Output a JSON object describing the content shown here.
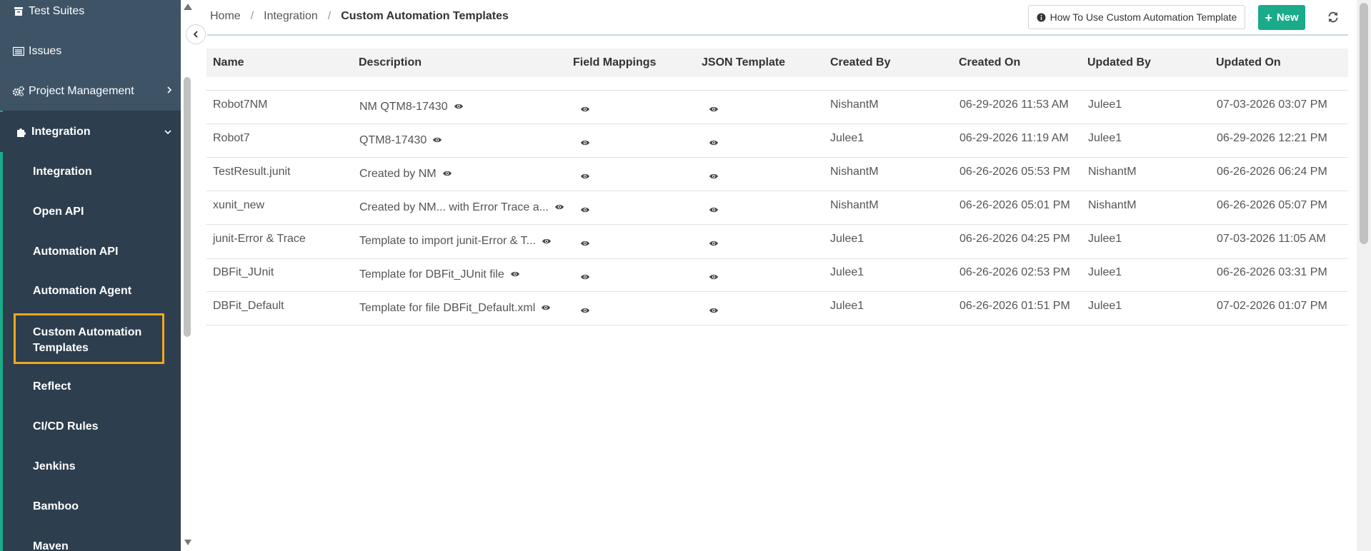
{
  "sidebar": {
    "top_items": [
      {
        "label": "Test Suites",
        "icon": "archive-icon"
      },
      {
        "label": "Issues",
        "icon": "list-icon"
      },
      {
        "label": "Project Management",
        "icon": "cogs-icon"
      }
    ],
    "parent": {
      "label": "Integration",
      "icon": "puzzle-icon"
    },
    "sub_items": [
      "Integration",
      "Open API",
      "Automation API",
      "Automation Agent",
      "Custom Automation Templates",
      "Reflect",
      "CI/CD Rules",
      "Jenkins",
      "Bamboo",
      "Maven"
    ]
  },
  "breadcrumb": {
    "home": "Home",
    "parent": "Integration",
    "current": "Custom Automation Templates"
  },
  "toolbar": {
    "howto_label": "How To Use Custom Automation Template",
    "new_label": "New"
  },
  "table": {
    "columns": [
      "Name",
      "Description",
      "Field Mappings",
      "JSON Template",
      "Created By",
      "Created On",
      "Updated By",
      "Updated On"
    ],
    "rows": [
      {
        "name": "Robot7NM",
        "description": "NM QTM8-17430",
        "created_by": "NishantM",
        "created_on": "06-29-2026 11:53 AM",
        "updated_by": "Julee1",
        "updated_on": "07-03-2026 03:07 PM"
      },
      {
        "name": "Robot7",
        "description": "QTM8-17430",
        "created_by": "Julee1",
        "created_on": "06-29-2026 11:19 AM",
        "updated_by": "Julee1",
        "updated_on": "06-29-2026 12:21 PM"
      },
      {
        "name": "TestResult.junit",
        "description": "Created by NM",
        "created_by": "NishantM",
        "created_on": "06-26-2026 05:53 PM",
        "updated_by": "NishantM",
        "updated_on": "06-26-2026 06:24 PM"
      },
      {
        "name": "xunit_new",
        "description": "Created by NM... with Error Trace a...",
        "created_by": "NishantM",
        "created_on": "06-26-2026 05:01 PM",
        "updated_by": "NishantM",
        "updated_on": "06-26-2026 05:07 PM"
      },
      {
        "name": "junit-Error & Trace",
        "description": "Template to import junit-Error & T...",
        "created_by": "Julee1",
        "created_on": "06-26-2026 04:25 PM",
        "updated_by": "Julee1",
        "updated_on": "07-03-2026 11:05 AM"
      },
      {
        "name": "DBFit_JUnit",
        "description": "Template for DBFit_JUnit file",
        "created_by": "Julee1",
        "created_on": "06-26-2026 02:53 PM",
        "updated_by": "Julee1",
        "updated_on": "06-26-2026 03:31 PM"
      },
      {
        "name": "DBFit_Default",
        "description": "Template for file DBFit_Default.xml",
        "created_by": "Julee1",
        "created_on": "06-26-2026 01:51 PM",
        "updated_by": "Julee1",
        "updated_on": "07-02-2026 01:07 PM"
      }
    ]
  },
  "colors": {
    "sidebar_bg": "#2d3e4e",
    "sidebar_top_bg": "#3e5366",
    "accent_green": "#1aab8a",
    "active_border": "#f0a81c"
  }
}
